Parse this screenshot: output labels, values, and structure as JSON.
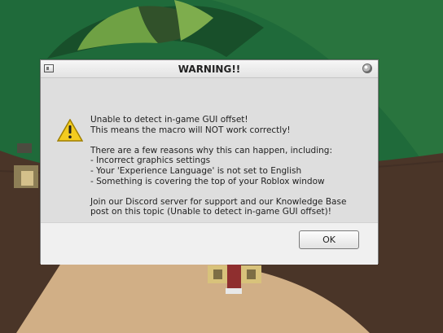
{
  "dialog": {
    "title": "WARNING!!",
    "message": "Unable to detect in-game GUI offset!\nThis means the macro will NOT work correctly!\n\nThere are a few reasons why this can happen, including:\n- Incorrect graphics settings\n- Your 'Experience Language' is not set to English\n- Something is covering the top of your Roblox window\n\nJoin our Discord server for support and our Knowledge Base\npost on this topic (Unable to detect in-game GUI offset)!",
    "ok_label": "OK"
  },
  "icons": {
    "app": "app-window-icon",
    "close": "close-icon",
    "warning": "warning-icon"
  },
  "colors": {
    "warning_yellow": "#f4cc1f",
    "scene_green": "#1f5f34",
    "floor_brown": "#4a3528",
    "floor_tan": "#d1af86"
  }
}
